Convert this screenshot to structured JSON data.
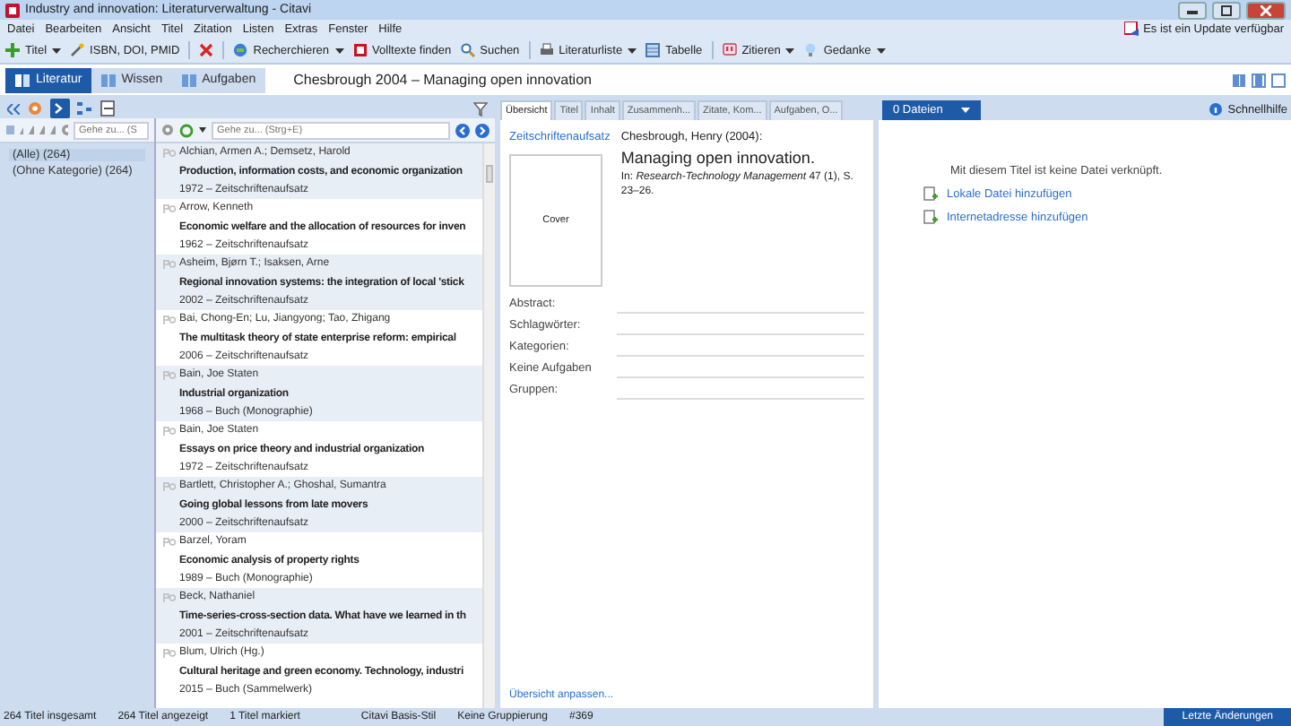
{
  "window": {
    "title": "Industry and innovation: Literaturverwaltung - Citavi"
  },
  "menu": [
    "Datei",
    "Bearbeiten",
    "Ansicht",
    "Titel",
    "Zitation",
    "Listen",
    "Extras",
    "Fenster",
    "Hilfe"
  ],
  "update_notice": "Es ist ein Update verfügbar",
  "toolbar": [
    {
      "label": "Titel",
      "dropdown": true
    },
    {
      "label": "ISBN, DOI, PMID",
      "dropdown": false
    },
    {
      "dropdown": false
    },
    {
      "label": "Recherchieren",
      "dropdown": true
    },
    {
      "label": "Volltexte finden",
      "dropdown": false
    },
    {
      "label": "Suchen",
      "dropdown": false
    },
    {
      "label": "Literaturliste",
      "dropdown": true
    },
    {
      "label": "Tabelle",
      "dropdown": false
    },
    {
      "label": "Zitieren",
      "dropdown": true
    },
    {
      "label": "Gedanke",
      "dropdown": true
    }
  ],
  "nav_tabs": [
    {
      "label": "Literatur",
      "selected": true
    },
    {
      "label": "Wissen",
      "selected": false
    },
    {
      "label": "Aufgaben",
      "selected": false
    }
  ],
  "heading": "Chesbrough 2004 – Managing open innovation",
  "categories": {
    "search": {
      "placeholder": "Gehe zu... (S"
    },
    "items": [
      {
        "label": "(Alle) (264)",
        "selected": true
      },
      {
        "label": "(Ohne Kategorie) (264)",
        "selected": false
      }
    ]
  },
  "references": {
    "search": {
      "placeholder": "Gehe zu... (Strg+E)"
    },
    "rows": [
      {
        "authors": "Alchian, Armen A.; Demsetz, Harold",
        "title": "Production, information costs, and economic organization",
        "meta": "1972 – Zeitschriftenaufsatz"
      },
      {
        "authors": "Arrow, Kenneth",
        "title": "Economic welfare and the allocation of resources for inven",
        "meta": "1962 – Zeitschriftenaufsatz"
      },
      {
        "authors": "Asheim, Bjørn T.; Isaksen, Arne",
        "title": "Regional innovation systems: the integration of local 'stick",
        "meta": "2002 – Zeitschriftenaufsatz"
      },
      {
        "authors": "Bai, Chong-En; Lu, Jiangyong; Tao, Zhigang",
        "title": "The multitask theory of state enterprise reform: empirical",
        "meta": "2006 – Zeitschriftenaufsatz"
      },
      {
        "authors": "Bain, Joe Staten",
        "title": "Industrial organization",
        "meta": "1968 – Buch (Monographie)"
      },
      {
        "authors": "Bain, Joe Staten",
        "title": "Essays on price theory and industrial organization",
        "meta": "1972 – Zeitschriftenaufsatz"
      },
      {
        "authors": "Bartlett, Christopher A.; Ghoshal, Sumantra",
        "title": "Going global lessons from late movers",
        "meta": "2000 – Zeitschriftenaufsatz"
      },
      {
        "authors": "Barzel, Yoram",
        "title": "Economic analysis of property rights",
        "meta": "1989 – Buch (Monographie)"
      },
      {
        "authors": "Beck, Nathaniel",
        "title": "Time-series-cross-section data. What have we learned in th",
        "meta": "2001 – Zeitschriftenaufsatz"
      },
      {
        "authors": "Blum, Ulrich (Hg.)",
        "title": "Cultural heritage and green economy. Technology, industri",
        "meta": "2015 – Buch (Sammelwerk)"
      }
    ]
  },
  "detail_tabs": [
    {
      "label": "Übersicht",
      "selected": true
    },
    {
      "label": "Titel",
      "selected": false
    },
    {
      "label": "Inhalt",
      "selected": false
    },
    {
      "label": "Zusammenh...",
      "selected": false
    },
    {
      "label": "Zitate, Kom...",
      "selected": false
    },
    {
      "label": "Aufgaben, O...",
      "selected": false
    }
  ],
  "overview": {
    "type_link": "Zeitschriftenaufsatz",
    "author": "Chesbrough, Henry (2004):",
    "title": "Managing open innovation.",
    "source": "In: *Research-Technology Management* 47 (1), S. 23–26.",
    "cover": "Cover",
    "fields": [
      "Abstract:",
      "Schlagwörter:",
      "Kategorien:",
      "Keine Aufgaben",
      "Gruppen:"
    ],
    "customize_link": "Übersicht anpassen..."
  },
  "attachments": {
    "files_button": "0 Dateien",
    "help": "Schnellhilfe",
    "message": "Mit diesem Titel ist keine Datei verknüpft.",
    "links": [
      "Lokale Datei hinzufügen",
      "Internetadresse hinzufügen"
    ]
  },
  "status_bar": {
    "items": [
      "264 Titel insgesamt",
      "264 Titel angezeigt",
      "1 Titel markiert",
      "Citavi Basis-Stil",
      "Keine Gruppierung",
      "#369"
    ],
    "button": "Letzte Änderungen"
  }
}
